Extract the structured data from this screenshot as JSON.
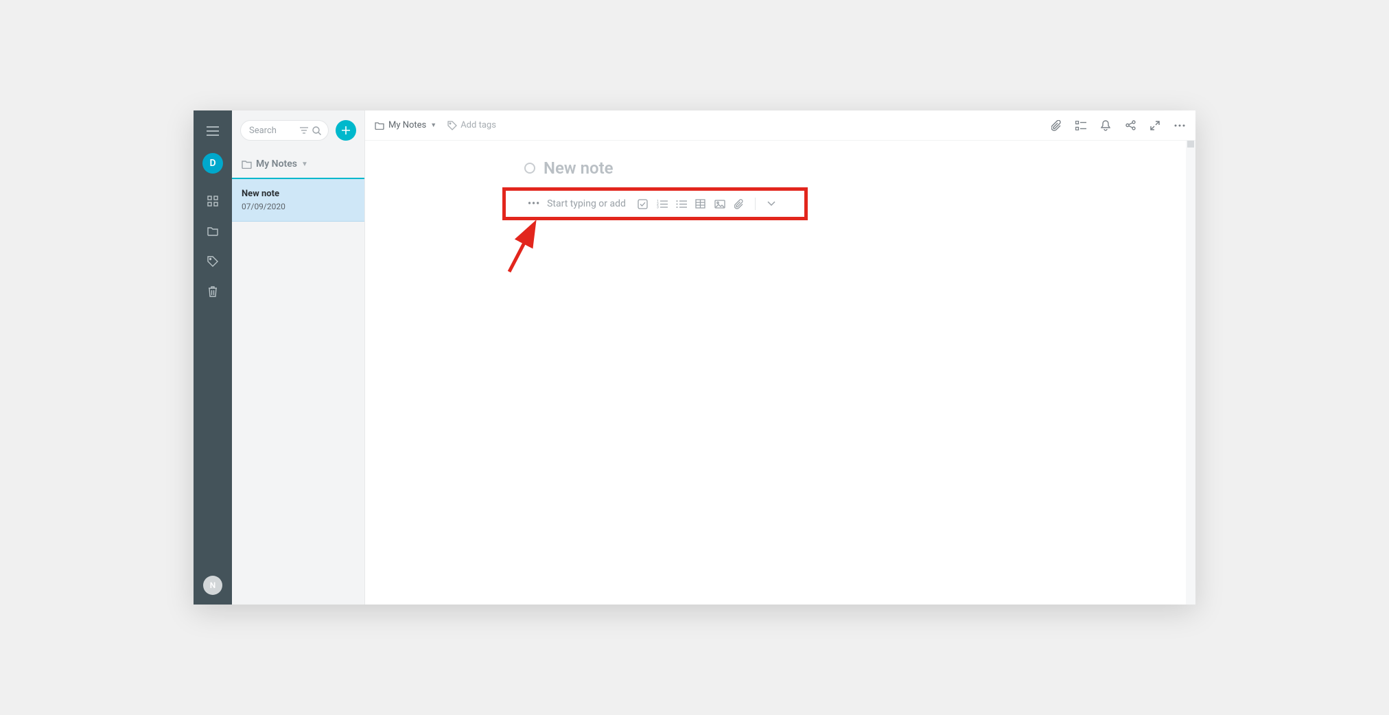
{
  "nav": {
    "user_initial": "D",
    "bottom_initial": "N"
  },
  "list": {
    "search_placeholder": "Search",
    "folder_label": "My Notes",
    "items": [
      {
        "title": "New note",
        "date": "07/09/2020"
      }
    ]
  },
  "editor": {
    "breadcrumb_label": "My Notes",
    "add_tags_label": "Add tags",
    "title_placeholder": "New note",
    "body_prompt": "Start typing or add"
  }
}
